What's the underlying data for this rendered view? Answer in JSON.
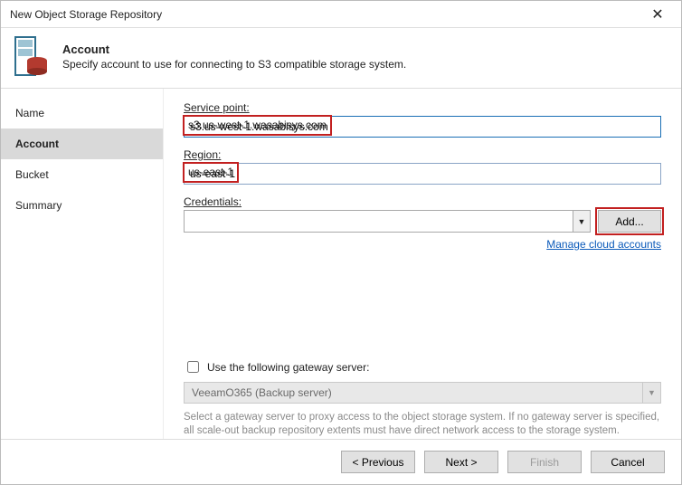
{
  "window": {
    "title": "New Object Storage Repository"
  },
  "header": {
    "title": "Account",
    "subtitle": "Specify account to use for connecting to S3 compatible storage system."
  },
  "steps": {
    "name": "Name",
    "account": "Account",
    "bucket": "Bucket",
    "summary": "Summary"
  },
  "form": {
    "service_point_label": "Service point:",
    "service_point_value": "s3.us-west-1.wasabisys.com",
    "region_label": "Region:",
    "region_value": "us-east-1",
    "credentials_label": "Credentials:",
    "credentials_value": "",
    "add_btn": "Add...",
    "manage_link": "Manage cloud accounts"
  },
  "gateway": {
    "checkbox_label": "Use the following gateway server:",
    "server_value": "VeeamO365 (Backup server)",
    "hint": "Select a gateway server to proxy access to the object storage system. If no gateway server is specified, all scale-out backup repository extents must have direct network access to the storage system."
  },
  "footer": {
    "previous": "< Previous",
    "next": "Next >",
    "finish": "Finish",
    "cancel": "Cancel"
  }
}
